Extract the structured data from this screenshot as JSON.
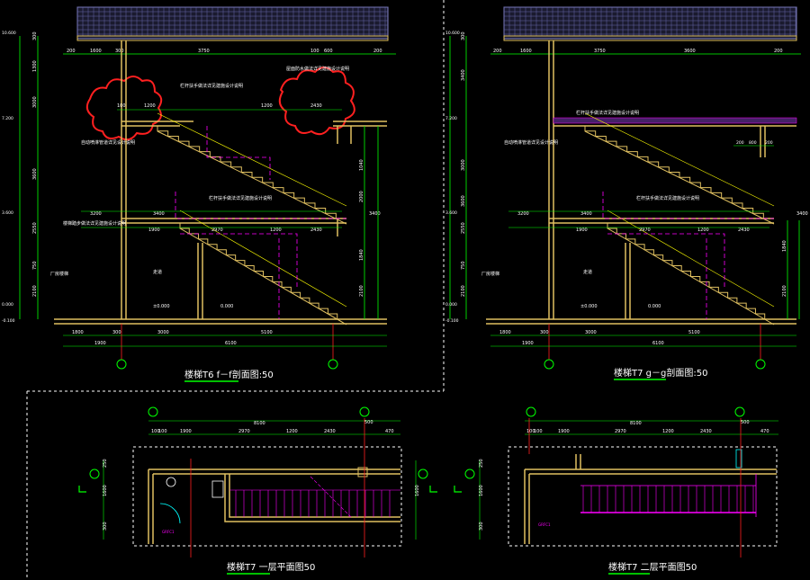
{
  "colors": {
    "background": "#000000",
    "wall": "#e0c060",
    "dim": "#00ff00",
    "grid": "#ff2020",
    "stair": "#ffff00",
    "hidden": "#ff00ff",
    "cloud": "#ff2020",
    "text_white": "#ffffff",
    "text_yellow": "#ffff40",
    "title_underline": "#00ff00",
    "frame": "#ffffff"
  },
  "titles": {
    "section_f": "楼梯T6 f－f剖面图:50",
    "section_g": "楼梯T7 g－g剖面图:50",
    "plan_1": "楼梯T7 一层平面图50",
    "plan_2": "楼梯T7 二层平面图50"
  },
  "section_f": {
    "top_dims": [
      "200",
      "1600",
      "300",
      "3750",
      "100",
      "600",
      "200"
    ],
    "mid_dims": [
      "100",
      "1200",
      "1200",
      "2430"
    ],
    "mid_dims2": [
      "3200",
      "3400",
      "3400"
    ],
    "floor_dims": [
      "1900",
      "2970",
      "1200",
      "2430"
    ],
    "bottom_dims": [
      "1800",
      "300",
      "3000",
      "5100"
    ],
    "overall_dims": [
      "1900",
      "6100"
    ],
    "left_levels": [
      "10.600",
      "7.200",
      "3.600",
      "0.000",
      "-0.100"
    ],
    "left_dims": [
      "300",
      "1300",
      "3000",
      "3600",
      "2550",
      "750",
      "2100"
    ],
    "right_dims": [
      "1040",
      "2000",
      "1840",
      "2100"
    ],
    "notes": [
      "栏杆扶手做法详见建施设计说明",
      "屋面防水做法详见建施设计说明",
      "栏杆扶手做法详见建施设计说明",
      "自动喷淋管道详见设计说明",
      "楼梯踏步做法详见建施设计说明",
      "厂房楼梯"
    ],
    "room": "走道",
    "floor_labels": [
      "±0.000",
      "0.000"
    ]
  },
  "section_g": {
    "top_dims": [
      "200",
      "1600",
      "3750",
      "3600",
      "200"
    ],
    "mid_dims": [
      "200",
      "800",
      "200"
    ],
    "mid_dims2": [
      "3200",
      "3400",
      "3400"
    ],
    "floor_dims": [
      "1900",
      "2970",
      "1200",
      "2430"
    ],
    "bottom_dims": [
      "1800",
      "300",
      "3000",
      "5100"
    ],
    "overall_dims": [
      "1900",
      "6100"
    ],
    "left_levels": [
      "10.600",
      "7.200",
      "3.600",
      "0.000",
      "-0.100"
    ],
    "left_dims": [
      "300",
      "3400",
      "3000",
      "3600",
      "2550",
      "750",
      "2100"
    ],
    "right_dims": [
      "1840",
      "2100"
    ],
    "notes": [
      "栏杆扶手做法详见建施设计说明",
      "自动喷淋管道详见设计说明",
      "栏杆扶手做法详见建施设计说明",
      "厂房楼梯"
    ],
    "room": "走道",
    "floor_labels": [
      "±0.000",
      "0.000"
    ]
  },
  "plan_1": {
    "overall": "8100",
    "dims": [
      "100",
      "100",
      "1900",
      "2970",
      "1200",
      "2430",
      "470"
    ],
    "right_dim": "500",
    "left_dims": [
      "250",
      "1600",
      "300"
    ],
    "right_dims": [
      "1600"
    ],
    "tag": "GRFC1"
  },
  "plan_2": {
    "overall": "8100",
    "dims": [
      "100",
      "100",
      "1900",
      "2970",
      "1200",
      "2430",
      "470"
    ],
    "right_dim": "500",
    "left_dims": [
      "250",
      "1600",
      "300"
    ],
    "tag": "GRFC1"
  }
}
